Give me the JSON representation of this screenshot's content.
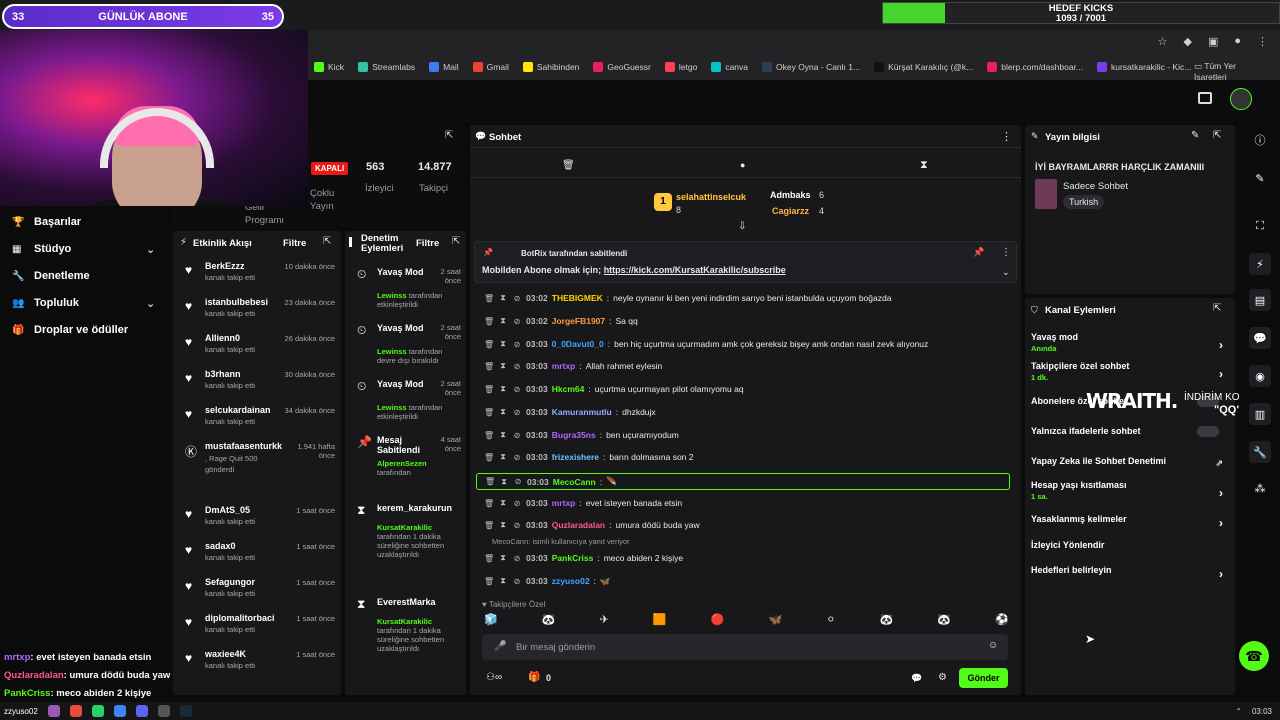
{
  "overlay": {
    "sub_left": "33",
    "sub_title": "GÜNLÜK ABONE",
    "sub_right": "35",
    "kicks_title": "HEDEF KICKS",
    "kicks_count": "1093 / 7001",
    "kicks_progress": 0.156
  },
  "browser": {
    "bookmarks": [
      {
        "label": "Kick",
        "color": "#53fc18"
      },
      {
        "label": "Streamlabs",
        "color": "#31c3a2"
      },
      {
        "label": "Mail",
        "color": "#3d7bf0"
      },
      {
        "label": "Gmail",
        "color": "#ea4335"
      },
      {
        "label": "Sahibinden",
        "color": "#ffe800"
      },
      {
        "label": "GeoGuessr",
        "color": "#e91e63"
      },
      {
        "label": "letgo",
        "color": "#ff3f55"
      },
      {
        "label": "canva",
        "color": "#00c4cc"
      },
      {
        "label": "Okey Oyna - Canlı 1...",
        "color": "#2c3e50"
      },
      {
        "label": "Kürşat Karakılıç (@k...",
        "color": "#111111"
      },
      {
        "label": "blerp.com/dashboar...",
        "color": "#e91e63"
      },
      {
        "label": "kursatkarakilic - Kic...",
        "color": "#7b3be8"
      }
    ],
    "all_bookmarks": "Tüm Yer İşaretleri"
  },
  "nav": {
    "items": [
      {
        "label": "Başarılar",
        "icon": "trophy-icon",
        "chevron": false
      },
      {
        "label": "Stüdyo",
        "icon": "studio-icon",
        "chevron": true
      },
      {
        "label": "Denetleme",
        "icon": "wrench-icon",
        "chevron": false
      },
      {
        "label": "Topluluk",
        "icon": "community-icon",
        "chevron": true
      },
      {
        "label": "Droplar ve ödüller",
        "icon": "gift-icon",
        "chevron": false
      }
    ]
  },
  "stats": {
    "status": "KAPALI",
    "viewers_value": "563",
    "followers_value": "14.877",
    "label_channel": "Çoklu Yayın",
    "label_viewers": "İzleyici",
    "label_followers": "Takipçi",
    "label_partner": "Gelir Programı"
  },
  "activity": {
    "title": "Etkinlik Akışı",
    "filter": "Filtre",
    "items": [
      {
        "name": "BerkEzzz",
        "sub": "kanalı takip etti",
        "time": "10 dakika önce"
      },
      {
        "name": "istanbulbebesi",
        "sub": "kanalı takip etti",
        "time": "23 dakika önce"
      },
      {
        "name": "Allienn0",
        "sub": "kanalı takip etti",
        "time": "26 dakika önce"
      },
      {
        "name": "b3rhann",
        "sub": "kanalı takip etti",
        "time": "30 dakika önce"
      },
      {
        "name": "selcukardainan",
        "sub": "kanalı takip etti",
        "time": "34 dakika önce"
      },
      {
        "name": "mustafaasenturkk",
        "sub": ", Rage Quit 500 gönderdi",
        "time": "1.941 hafta önce"
      },
      {
        "name": "DmAtS_05",
        "sub": "kanalı takip etti",
        "time": "1 saat önce"
      },
      {
        "name": "sadax0",
        "sub": "kanalı takip etti",
        "time": "1 saat önce"
      },
      {
        "name": "Sefagungor",
        "sub": "kanalı takip etti",
        "time": "1 saat önce"
      },
      {
        "name": "diplomalitorbaci",
        "sub": "kanalı takip etti",
        "time": "1 saat önce"
      },
      {
        "name": "waxiee4K",
        "sub": "kanalı takip etti",
        "time": "1 saat önce"
      }
    ]
  },
  "moderation": {
    "title": "Denetim Eylemleri",
    "filter": "Filtre",
    "items": [
      {
        "title": "Yavaş Mod",
        "time": "2 saat önce",
        "by": "Lewinss",
        "by_rest": "tarafından etkinleştirildi"
      },
      {
        "title": "Yavaş Mod",
        "time": "2 saat önce",
        "by": "Lewinss",
        "by_rest": "tarafından devre dışı bırakıldı"
      },
      {
        "title": "Yavaş Mod",
        "time": "2 saat önce",
        "by": "Lewinss",
        "by_rest": "tarafından etkinleştirildi"
      },
      {
        "title": "Mesaj Sabitlendi",
        "time": "4 saat önce",
        "by": "AlperenSezen",
        "by_rest": "tarafından"
      },
      {
        "title": "kerem_karakurun",
        "time": "",
        "by": "KursatKarakilic",
        "by_rest": "tarafından 1 dakika süreliğine sohbetten uzaklaştırıldı"
      },
      {
        "title": "EverestMarka",
        "time": "",
        "by": "KursatKarakilic",
        "by_rest": "tarafından 1 dakika süreliğine sohbetten uzaklaştırıldı"
      }
    ]
  },
  "chat": {
    "title": "Sohbet",
    "top_users": [
      {
        "name": "selahattinselcuk",
        "count": "8"
      },
      {
        "name": "Admbaks",
        "count": "6"
      },
      {
        "name": "Cagiarzz",
        "count": "4"
      }
    ],
    "pinned_by": "BotRix tarafından sabitlendi",
    "pinned_text": "Mobilden Abone olmak için;",
    "pinned_link": "https://kick.com/KursatKarakilic/subscribe",
    "messages": [
      {
        "time": "03:02",
        "user": "THEBIGMEK",
        "color": "#ffd000",
        "text": "neyle oynanır ki ben yeni indirdim sarıyo beni istanbulda uçuyom boğazda"
      },
      {
        "time": "03:02",
        "user": "JorgeFB1907",
        "color": "#ff9b3d",
        "text": "Sa qq"
      },
      {
        "time": "03:03",
        "user": "0_0Davut0_0",
        "color": "#3da7ff",
        "text": "ben hiç uçurtma uçurmadım amk çok gereksiz bişey amk ondan nasıl zevk alıyonuz"
      },
      {
        "time": "03:03",
        "user": "mrtxp",
        "color": "#b266ff",
        "text": "Allah rahmet eylesin"
      },
      {
        "time": "03:03",
        "user": "Hkcm64",
        "color": "#53fc18",
        "text": "uçurtma uçurmayan pilot olamıyomu aq"
      },
      {
        "time": "03:03",
        "user": "Kamuranmutlu",
        "color": "#8fb0ff",
        "text": "dhzkdujx"
      },
      {
        "time": "03:03",
        "user": "Bugra35ns",
        "color": "#b266ff",
        "text": "ben uçuramıyodum"
      },
      {
        "time": "03:03",
        "user": "frizexishere",
        "color": "#6ec6ff",
        "text": "barın dolmasına son 2"
      },
      {
        "time": "03:03",
        "user": "MecoCann",
        "color": "#53fc18",
        "text": "🪶"
      },
      {
        "time": "03:03",
        "user": "mrtxp",
        "color": "#b266ff",
        "text": "evet isteyen banada etsin"
      },
      {
        "time": "03:03",
        "user": "Quzlaradalan",
        "color": "#ff5a8a",
        "text": "umura dödü buda yaw"
      },
      {
        "time": "03:03",
        "user": "PankCriss",
        "color": "#53fc18",
        "text": "meco abiden 2 kişiye"
      },
      {
        "time": "03:03",
        "user": "zzyuso02",
        "color": "#3da7ff",
        "text": "🦋"
      }
    ],
    "reply_hint": "MecoCann:",
    "reply_hint_rest": "isimli kullanıcıya yanıt veriyor",
    "follower_only": "Takipçilere Özel",
    "input_placeholder": "Bir mesaj gönderin",
    "send_label": "Gönder",
    "points": "0"
  },
  "info": {
    "title": "Yayın bilgisi",
    "stream_title": "İYİ BAYRAMLARRR HARÇLIK ZAMANIII",
    "category": "Sadece Sohbet",
    "tag": "Turkish"
  },
  "actions": {
    "title": "Kanal Eylemleri",
    "items": [
      {
        "label": "Yavaş mod",
        "sub": "Anında",
        "type": "chevron"
      },
      {
        "label": "Takipçilere özel sohbet",
        "sub": "1 dk.",
        "type": "chevron"
      },
      {
        "label": "Abonelere özel sohbet",
        "sub": "",
        "type": "toggle"
      },
      {
        "label": "Yalnızca ifadelerle sohbet",
        "sub": "",
        "type": "toggle"
      },
      {
        "label": "Yapay Zeka ile Sohbet Denetimi",
        "sub": "",
        "type": "external"
      },
      {
        "label": "Hesap yaşı kısıtlaması",
        "sub": "1 sa.",
        "type": "chevron"
      },
      {
        "label": "Yasaklanmış kelimeler",
        "sub": "",
        "type": "chevron"
      },
      {
        "label": "İzleyici Yönlendir",
        "sub": "",
        "type": "none"
      },
      {
        "label": "Hedefleri belirleyin",
        "sub": "",
        "type": "chevron"
      }
    ]
  },
  "sponsor": {
    "brand": "WRAITH.",
    "discount_label": "İNDİRİM KODU:",
    "discount_code": "\"QQ\""
  },
  "overlay_chat": [
    {
      "user": "mrtxp",
      "color": "#b266ff",
      "text": ": evet isteyen banada etsin"
    },
    {
      "user": "Quzlaradalan",
      "color": "#ff5a8a",
      "text": ": umura dödü buda yaw"
    },
    {
      "user": "PankCriss",
      "color": "#53fc18",
      "text": ": meco abiden 2 kişiye"
    }
  ],
  "taskbar": {
    "time": "03:03",
    "overlay_name": "zzyuso02"
  }
}
